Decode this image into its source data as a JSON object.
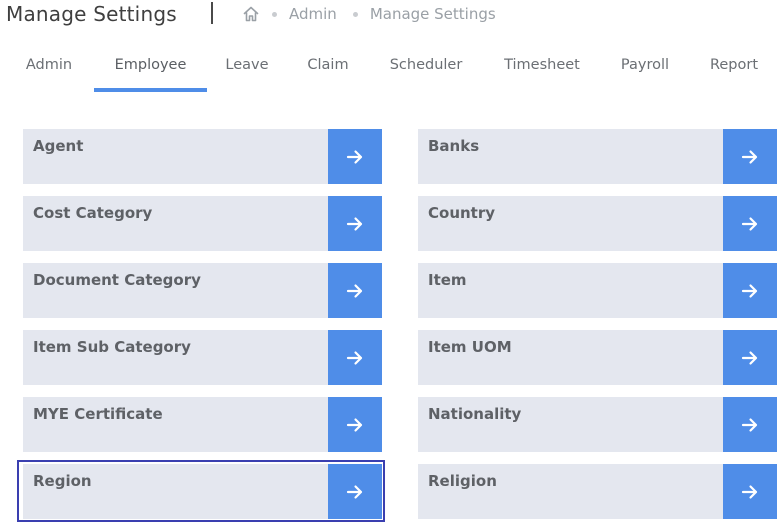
{
  "header": {
    "title": "Manage Settings",
    "breadcrumb": [
      "Admin",
      "Manage Settings"
    ]
  },
  "tabs": [
    {
      "label": "Admin",
      "active": false
    },
    {
      "label": "Employee",
      "active": true
    },
    {
      "label": "Leave",
      "active": false
    },
    {
      "label": "Claim",
      "active": false
    },
    {
      "label": "Scheduler",
      "active": false
    },
    {
      "label": "Timesheet",
      "active": false
    },
    {
      "label": "Payroll",
      "active": false
    },
    {
      "label": "Report",
      "active": false
    }
  ],
  "settings": {
    "left": [
      "Agent",
      "Cost Category",
      "Document Category",
      "Item Sub Category",
      "MYE Certificate",
      "Region"
    ],
    "right": [
      "Banks",
      "Country",
      "Item",
      "Item UOM",
      "Nationality",
      "Religion"
    ]
  },
  "colors": {
    "accent": "#4f8de8",
    "card_bg": "#e4e7ef",
    "focus_ring": "#3a3fb0"
  }
}
